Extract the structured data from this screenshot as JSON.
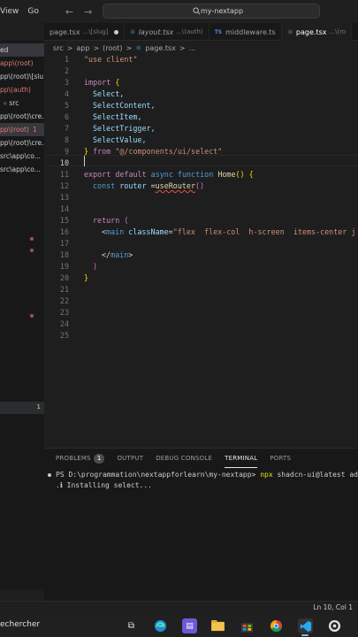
{
  "titlebar": {
    "menu": [
      "View",
      "Go"
    ],
    "back_icon": "arrow-left-icon",
    "forward_icon": "arrow-right-icon",
    "search_text": "my-nextapp"
  },
  "tabs": [
    {
      "name": "page.tsx",
      "hint": "...\\[slug]",
      "dirty": true
    },
    {
      "name": "layout.tsx",
      "hint": "...\\(auth)",
      "italic": true
    },
    {
      "name": "middleware.ts",
      "hint": "",
      "prefix": "TS"
    },
    {
      "name": "page.tsx",
      "hint": "...\\(ro",
      "active": true
    }
  ],
  "breadcrumb": [
    "src",
    ">",
    "app",
    ">",
    "(root)",
    ">",
    "page.tsx",
    ">",
    "..."
  ],
  "sidebar": {
    "items": [
      {
        "label": "ed",
        "style": "active"
      },
      {
        "label": "app\\(root)",
        "style": "red"
      },
      {
        "label": "pp\\(root)\\[slu...",
        "style": "normal"
      },
      {
        "label": "pp\\(auth)",
        "style": "red"
      },
      {
        "label": "src",
        "style": "normal"
      },
      {
        "label": "pp\\(root)\\cre...",
        "style": "normal"
      },
      {
        "label": "pp\\(root)",
        "style": "red",
        "count": "1"
      },
      {
        "label": "pp\\(root)\\cre...",
        "style": "normal"
      },
      {
        "label": "src\\app\\co...",
        "style": "normal"
      },
      {
        "label": "src\\app\\co...",
        "style": "normal"
      }
    ],
    "problems_count": "1"
  },
  "editor": {
    "current_line": "10",
    "lines": [
      {
        "n": "1"
      },
      {
        "n": "2"
      },
      {
        "n": "3"
      },
      {
        "n": "4"
      },
      {
        "n": "5"
      },
      {
        "n": "6"
      },
      {
        "n": "7"
      },
      {
        "n": "8"
      },
      {
        "n": "9"
      },
      {
        "n": "10"
      },
      {
        "n": "11"
      },
      {
        "n": "12"
      },
      {
        "n": "13"
      },
      {
        "n": "14"
      },
      {
        "n": "15"
      },
      {
        "n": "16"
      },
      {
        "n": "17"
      },
      {
        "n": "18"
      },
      {
        "n": "19"
      },
      {
        "n": "20"
      },
      {
        "n": "21"
      },
      {
        "n": "22"
      },
      {
        "n": "23"
      },
      {
        "n": "24"
      },
      {
        "n": "25"
      }
    ],
    "code": {
      "l1": "\"use client\"",
      "l3_kw": "import",
      "l3_br": "{",
      "imports": [
        "Select,",
        "SelectContent,",
        "SelectItem,",
        "SelectTrigger,",
        "SelectValue,"
      ],
      "l9_br": "}",
      "l9_from": "from",
      "l9_path": "\"@/components/ui/select\"",
      "l11_export": "export",
      "l11_default": "default",
      "l11_async": "async",
      "l11_function": "function",
      "l11_name": "Home",
      "l11_parens": "()",
      "l11_brace": "{",
      "l12_const": "const",
      "l12_var": "router",
      "l12_eq": "=",
      "l12_call": "useRouter",
      "l12_parens": "()",
      "l15_return": "return",
      "l15_paren": "(",
      "l16_open": "<",
      "l16_tag": "main",
      "l16_attr": "className",
      "l16_eq": "=",
      "l16_val": "\"flex  flex-col  h-screen  items-center j",
      "l18_close_open": "</",
      "l18_tag": "main",
      "l18_close": ">",
      "l19_paren": ")",
      "l20_brace": "}"
    }
  },
  "panel": {
    "tabs": [
      "PROBLEMS",
      "OUTPUT",
      "DEBUG CONSOLE",
      "TERMINAL",
      "PORTS"
    ],
    "problems_badge": "1",
    "active_tab": "TERMINAL",
    "prompt": "PS D:\\programmation\\nextappforlearn\\my-nextapp>",
    "command": "npx",
    "command_rest": "shadcn-ui@latest add",
    "output": ".ℹ Installing select..."
  },
  "statusbar": {
    "position": "Ln 10, Col 1"
  },
  "taskbar": {
    "search_text": "echercher",
    "icons": [
      "task-view-icon",
      "edge-icon",
      "app-icon",
      "file-explorer-icon",
      "store-icon",
      "chrome-icon",
      "vscode-icon",
      "github-desktop-icon"
    ]
  },
  "colors": {
    "background": "#1e1e1e",
    "keyword": "#569cd6",
    "control_keyword": "#c586c0",
    "function": "#dcdcaa",
    "string": "#ce9178",
    "identifier": "#9cdcfe"
  }
}
